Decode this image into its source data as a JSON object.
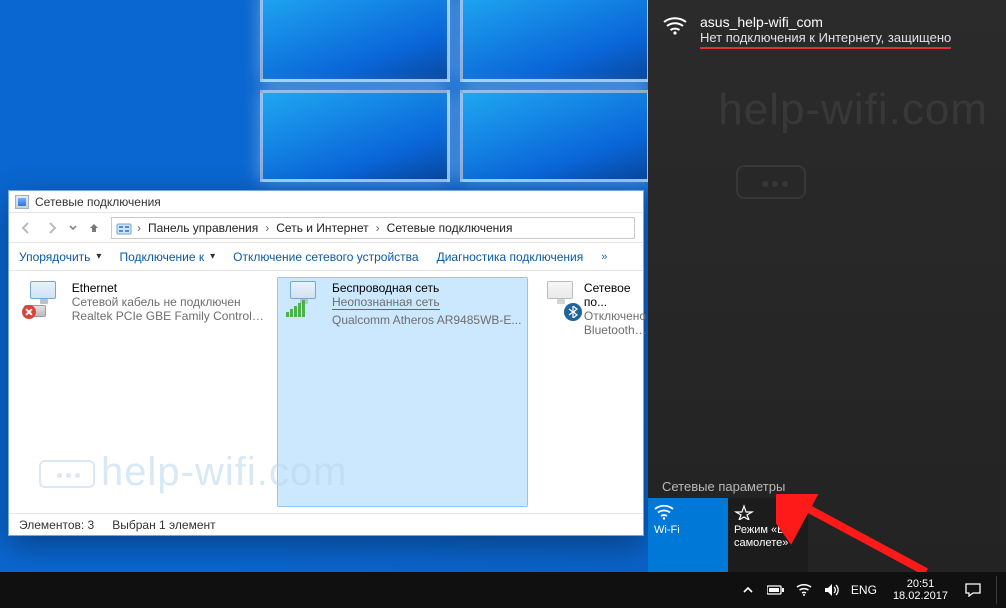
{
  "window": {
    "title": "Сетевые подключения",
    "breadcrumb": [
      "Панель управления",
      "Сеть и Интернет",
      "Сетевые подключения"
    ],
    "toolbar": {
      "organize": "Упорядочить",
      "connect": "Подключение к",
      "disable": "Отключение сетевого устройства",
      "diagnose": "Диагностика подключения"
    },
    "status": {
      "count_lbl": "Элементов:",
      "count": "3",
      "sel_lbl": "Выбран 1 элемент"
    }
  },
  "connections": [
    {
      "name": "Ethernet",
      "sub1": "Сетевой кабель не подключен",
      "sub2": "Realtek PCIe GBE Family Controller"
    },
    {
      "name": "Беспроводная сеть",
      "sub1": "Неопознанная сеть",
      "sub2": "Qualcomm Atheros AR9485WB-E..."
    },
    {
      "name": "Сетевое по...",
      "sub1": "Отключено",
      "sub2": "Bluetooth D..."
    }
  ],
  "flyout": {
    "ssid": "asus_help-wifi_com",
    "status": "Нет подключения к Интернету, защищено",
    "settings": "Сетевые параметры",
    "tiles": {
      "wifi": "Wi-Fi",
      "airplane_l1": "Режим «В",
      "airplane_l2": "самолете»"
    }
  },
  "taskbar": {
    "lang": "ENG",
    "time": "20:51",
    "date": "18.02.2017"
  },
  "watermark": "help-wifi.com"
}
